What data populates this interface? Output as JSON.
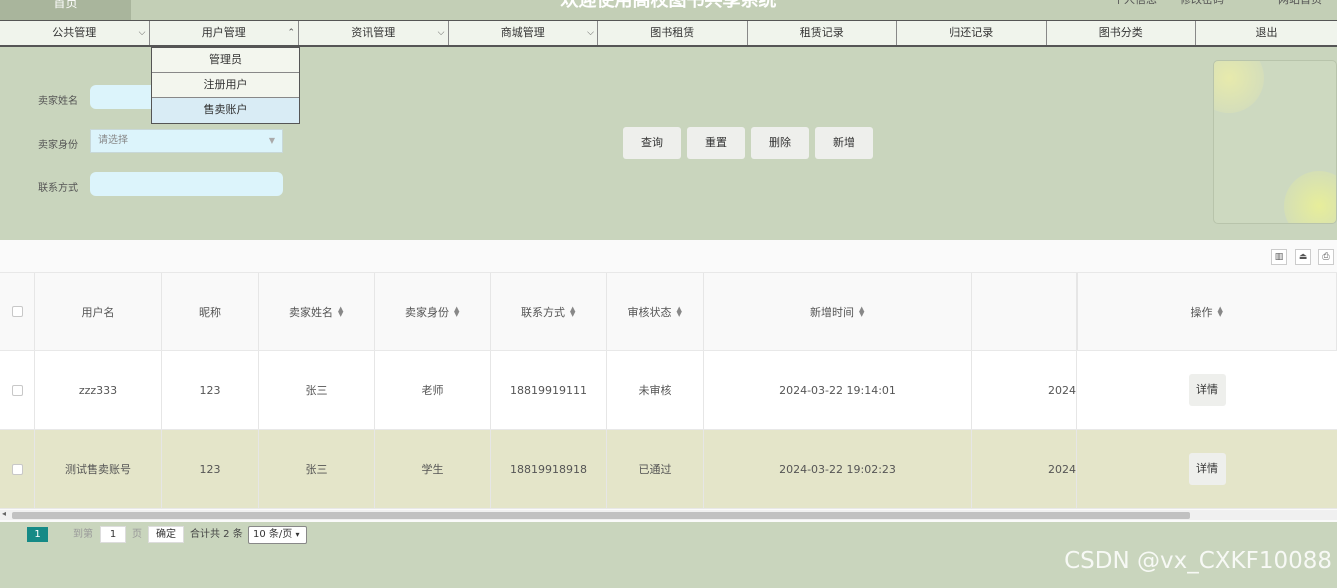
{
  "header": {
    "home_label": "首页",
    "site_title": "欢迎使用高校图书共享系统",
    "profile_link": "个人信息",
    "change_password_link": "修改密码",
    "site_home_link": "网站首页"
  },
  "nav": {
    "items": [
      {
        "label": "公共管理"
      },
      {
        "label": "用户管理"
      },
      {
        "label": "资讯管理"
      },
      {
        "label": "商城管理"
      },
      {
        "label": "图书租赁"
      },
      {
        "label": "租赁记录"
      },
      {
        "label": "归还记录"
      },
      {
        "label": "图书分类"
      },
      {
        "label": "退出"
      }
    ],
    "user_menu_items": [
      "管理员",
      "注册用户",
      "售卖账户"
    ]
  },
  "search": {
    "seller_name_label": "卖家姓名",
    "seller_identity_label": "卖家身份",
    "seller_identity_placeholder": "请选择",
    "contact_label": "联系方式",
    "query_button": "查询",
    "reset_button": "重置",
    "delete_button": "删除",
    "add_button": "新增"
  },
  "table": {
    "headers": [
      "用户名",
      "昵称",
      "卖家姓名",
      "卖家身份",
      "联系方式",
      "审核状态",
      "新增时间",
      "",
      "操作"
    ],
    "rows": [
      {
        "username": "zzz333",
        "nickname": "123",
        "seller_name": "张三",
        "identity": "老师",
        "contact": "18819919111",
        "status": "未审核",
        "created": "2024-03-22 19:14:01",
        "extra": "2024",
        "action": "详情"
      },
      {
        "username": "测试售卖账号",
        "nickname": "123",
        "seller_name": "张三",
        "identity": "学生",
        "contact": "18819918918",
        "status": "已通过",
        "created": "2024-03-22 19:02:23",
        "extra": "2024",
        "action": "详情"
      }
    ]
  },
  "pagination": {
    "current_page": "1",
    "goto_label": "到第",
    "goto_value": "1",
    "page_unit": "页",
    "confirm_button": "确定",
    "total_text": "合计共 2 条",
    "page_size": "10 条/页"
  },
  "watermark": "CSDN @vx_CXKF10088"
}
